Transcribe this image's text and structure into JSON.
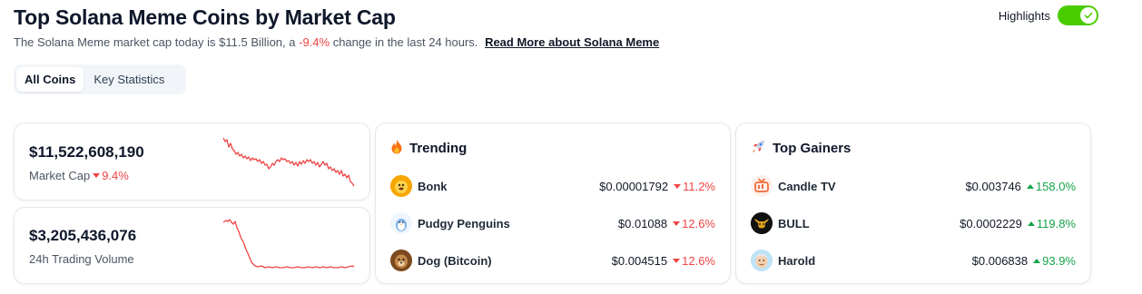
{
  "header": {
    "title": "Top Solana Meme Coins by Market Cap",
    "subtitle_prefix": "The Solana Meme market cap today is $11.5 Billion, a",
    "subtitle_change": "-9.4%",
    "subtitle_suffix": "change in the last 24 hours.",
    "read_more": "Read More about Solana Meme"
  },
  "highlights": {
    "label": "Highlights",
    "enabled": true
  },
  "tabs": [
    {
      "label": "All Coins",
      "active": true
    },
    {
      "label": "Key Statistics",
      "active": false
    }
  ],
  "stats": {
    "market_cap": {
      "value": "$11,522,608,190",
      "label": "Market Cap",
      "change": "9.4%",
      "direction": "down"
    },
    "volume": {
      "value": "$3,205,436,076",
      "label": "24h Trading Volume"
    }
  },
  "trending": {
    "title": "Trending",
    "icon": "fire-icon",
    "items": [
      {
        "name": "Bonk",
        "price": "$0.00001792",
        "change": "11.2%",
        "direction": "down",
        "icon": "bonk-icon"
      },
      {
        "name": "Pudgy Penguins",
        "price": "$0.01088",
        "change": "12.6%",
        "direction": "down",
        "icon": "pudgy-penguins-icon"
      },
      {
        "name": "Dog (Bitcoin)",
        "price": "$0.004515",
        "change": "12.6%",
        "direction": "down",
        "icon": "dog-bitcoin-icon"
      }
    ]
  },
  "gainers": {
    "title": "Top Gainers",
    "icon": "rocket-icon",
    "items": [
      {
        "name": "Candle TV",
        "price": "$0.003746",
        "change": "158.0%",
        "direction": "up",
        "icon": "candle-tv-icon"
      },
      {
        "name": "BULL",
        "price": "$0.0002229",
        "change": "119.8%",
        "direction": "up",
        "icon": "bull-icon"
      },
      {
        "name": "Harold",
        "price": "$0.006838",
        "change": "93.9%",
        "direction": "up",
        "icon": "harold-icon"
      }
    ]
  },
  "colors": {
    "negative": "#ef4444",
    "positive": "#16a34a",
    "toggle": "#4bcc00",
    "sparkline": "#ef4444"
  }
}
